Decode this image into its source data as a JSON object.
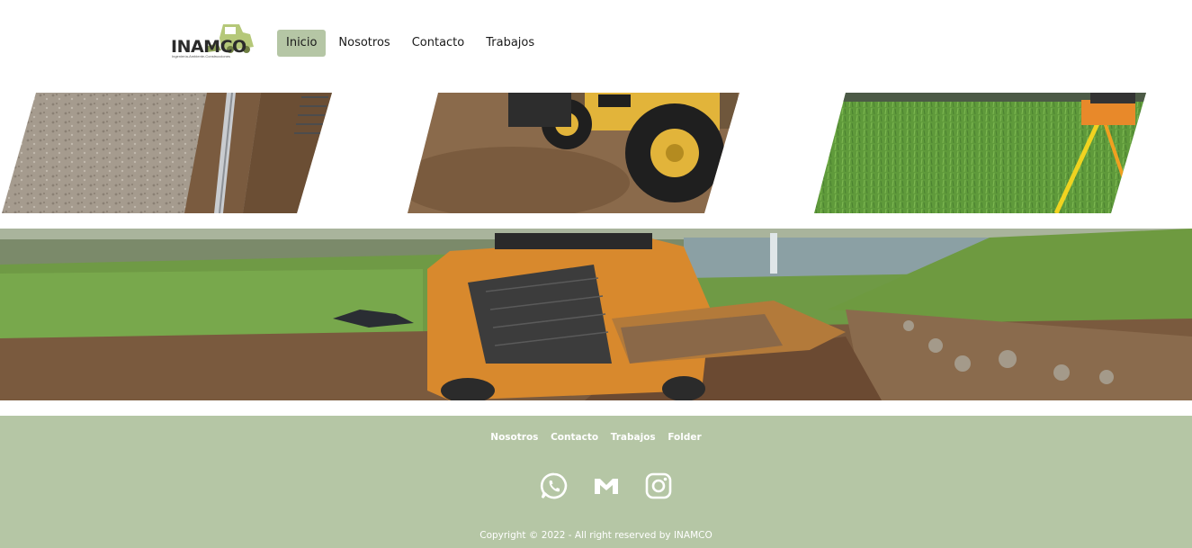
{
  "header": {
    "logo_text": "INAMCO",
    "logo_subtitle": "Ingeniería-Ambiente-Construcciones",
    "nav": [
      {
        "label": "Inicio",
        "active": true
      },
      {
        "label": "Nosotros",
        "active": false
      },
      {
        "label": "Contacto",
        "active": false
      },
      {
        "label": "Trabajos",
        "active": false
      }
    ]
  },
  "gallery": {
    "tiles": [
      {
        "subject": "excavated-trench"
      },
      {
        "subject": "jcb-loader"
      },
      {
        "subject": "grass-survey-tripod"
      }
    ],
    "banner": {
      "subject": "skid-steer-loader-golf-course"
    }
  },
  "footer": {
    "links": [
      "Nosotros",
      "Contacto",
      "Trabajos",
      "Folder"
    ],
    "social_icons": [
      "whatsapp-icon",
      "gmail-icon",
      "instagram-icon"
    ],
    "copyright": "Copyright © 2022 - All right reserved by INAMCO"
  },
  "colors": {
    "accent": "#b5c6a5",
    "footer_bg": "#b5c6a5",
    "footer_text": "#ffffff",
    "text": "#1a1a1a"
  }
}
